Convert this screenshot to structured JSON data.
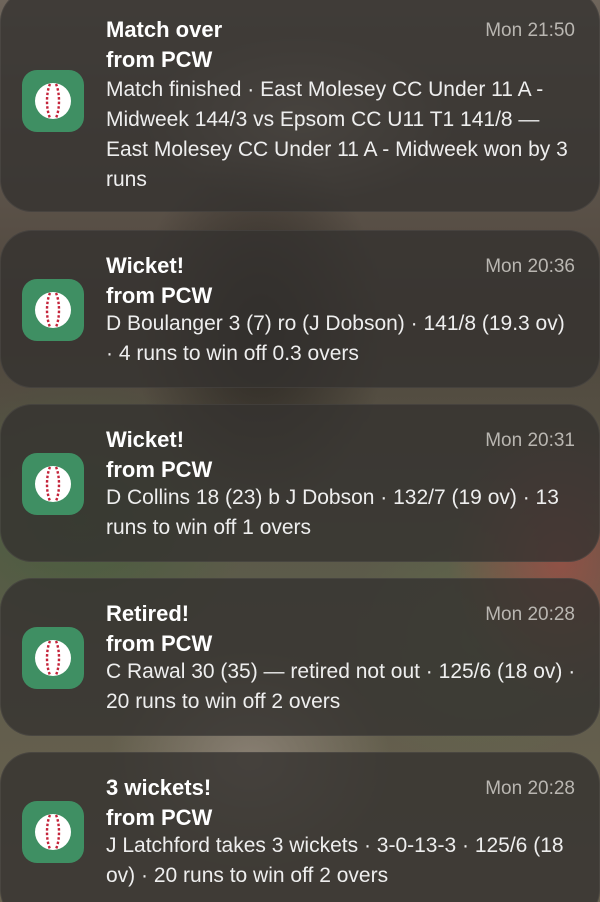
{
  "colors": {
    "app_icon_bg": "#3f8f63",
    "card_bg": "rgba(52,50,47,0.80)",
    "ball": "#ffffff",
    "seam": "#c4233a"
  },
  "notifications": [
    {
      "icon": "cricket-ball-icon",
      "title": "Match over",
      "from": "from PCW",
      "time": "Mon 21:50",
      "body": "Match finished · East Molesey CC Under 11 A - Midweek  144/3 vs Epsom CC U11 T1 141/8 — East Molesey CC Under 11 A - Midweek  won by 3 runs"
    },
    {
      "icon": "cricket-ball-icon",
      "title": "Wicket!",
      "from": "from PCW",
      "time": "Mon 20:36",
      "body": "D Boulanger 3 (7) ro (J Dobson) · 141/8 (19.3 ov) · 4 runs to win off 0.3 overs"
    },
    {
      "icon": "cricket-ball-icon",
      "title": "Wicket!",
      "from": "from PCW",
      "time": "Mon 20:31",
      "body": "D Collins 18 (23) b J Dobson · 132/7 (19 ov) · 13 runs to win off 1 overs"
    },
    {
      "icon": "cricket-ball-icon",
      "title": "Retired!",
      "from": "from PCW",
      "time": "Mon 20:28",
      "body": "C Rawal 30 (35) — retired not out · 125/6 (18 ov) · 20 runs to win off 2 overs"
    },
    {
      "icon": "cricket-ball-icon",
      "title": "3 wickets!",
      "from": "from PCW",
      "time": "Mon 20:28",
      "body": "J Latchford takes 3 wickets · 3-0-13-3 · 125/6 (18 ov) · 20 runs to win off 2 overs"
    }
  ]
}
